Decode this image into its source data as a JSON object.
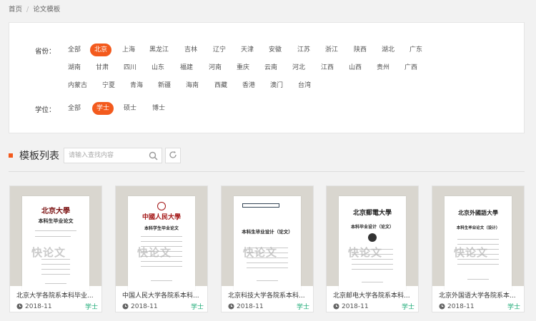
{
  "breadcrumb": {
    "home": "首页",
    "separator": "/",
    "current": "论文模板"
  },
  "filters": {
    "province": {
      "label": "省份：",
      "options": [
        "全部",
        "北京",
        "上海",
        "黑龙江",
        "吉林",
        "辽宁",
        "天津",
        "安徽",
        "江苏",
        "浙江",
        "陕西",
        "湖北",
        "广东",
        "湖南",
        "甘肃",
        "四川",
        "山东",
        "福建",
        "河南",
        "重庆",
        "云南",
        "河北",
        "江西",
        "山西",
        "贵州",
        "广西",
        "内蒙古",
        "宁夏",
        "青海",
        "新疆",
        "海南",
        "西藏",
        "香港",
        "澳门",
        "台湾"
      ],
      "selected": "北京"
    },
    "degree": {
      "label": "学位：",
      "options": [
        "全部",
        "学士",
        "硕士",
        "博士"
      ],
      "selected": "学士"
    }
  },
  "list": {
    "title": "模板列表",
    "search_placeholder": "请输入查找内容",
    "icons": {
      "search": "search-icon",
      "refresh": "refresh-icon"
    }
  },
  "cards": [
    {
      "name": "北京大学各院系本科毕业...",
      "date": "2018-11",
      "degree": "学士",
      "doc_title": "本科生毕业论文"
    },
    {
      "name": "中国人民大学各院系本科...",
      "date": "2018-11",
      "degree": "学士",
      "doc_title": "本科学生毕业论文"
    },
    {
      "name": "北京科技大学各院系本科...",
      "date": "2018-11",
      "degree": "学士",
      "doc_title": "本科生毕业设计（论文）"
    },
    {
      "name": "北京邮电大学各院系本科...",
      "date": "2018-11",
      "degree": "学士",
      "doc_title": "本科毕业设计（论文）"
    },
    {
      "name": "北京外国语大学各院系本...",
      "date": "2018-11",
      "degree": "学士",
      "doc_title": "本科生毕业论文（设计）"
    }
  ],
  "watermark": "快论文",
  "colors": {
    "accent": "#f35a1d",
    "degree": "#19a974"
  }
}
